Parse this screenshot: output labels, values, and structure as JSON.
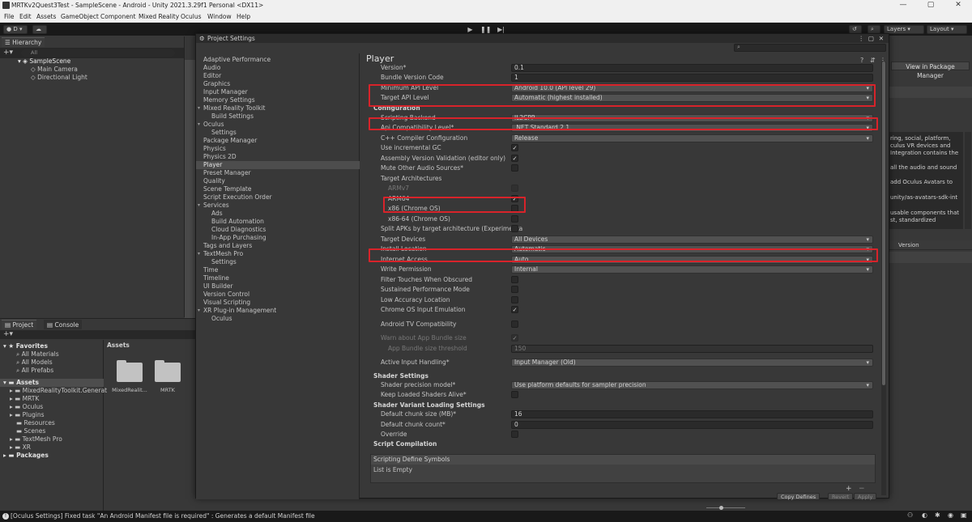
{
  "window": {
    "title": "MRTKv2Quest3Test - SampleScene - Android - Unity 2021.3.29f1 Personal <DX11>",
    "controls": [
      "—",
      "▢",
      "✕"
    ]
  },
  "menu": [
    "File",
    "Edit",
    "Assets",
    "GameObject",
    "Component",
    "Mixed Reality",
    "Oculus",
    "Window",
    "Help"
  ],
  "toolbar": {
    "account": "D",
    "layers": "Layers",
    "layout": "Layout"
  },
  "hierarchy": {
    "tab": "Hierarchy",
    "search_placeholder": "All",
    "scene": "SampleScene",
    "items": [
      "Main Camera",
      "Directional Light"
    ]
  },
  "project": {
    "tabs": [
      "Project",
      "Console"
    ],
    "favorites": {
      "label": "Favorites",
      "items": [
        "All Materials",
        "All Models",
        "All Prefabs"
      ]
    },
    "assets_root": "Assets",
    "asset_folders": [
      "MixedRealityToolkit.Generat",
      "MRTK",
      "Oculus",
      "Plugins",
      "Resources",
      "Scenes",
      "TextMesh Pro",
      "XR"
    ],
    "packages": "Packages",
    "breadcrumb": "Assets",
    "grid": [
      {
        "name": "MixedRealit..."
      },
      {
        "name": "MRTK"
      }
    ]
  },
  "settings": {
    "title": "Project Settings",
    "nav": [
      {
        "label": "Adaptive Performance",
        "level": 0
      },
      {
        "label": "Audio",
        "level": 0
      },
      {
        "label": "Editor",
        "level": 0
      },
      {
        "label": "Graphics",
        "level": 0
      },
      {
        "label": "Input Manager",
        "level": 0
      },
      {
        "label": "Memory Settings",
        "level": 0
      },
      {
        "label": "Mixed Reality Toolkit",
        "level": 0,
        "expanded": true
      },
      {
        "label": "Build Settings",
        "level": 1
      },
      {
        "label": "Oculus",
        "level": 0,
        "expanded": true
      },
      {
        "label": "Settings",
        "level": 1
      },
      {
        "label": "Package Manager",
        "level": 0
      },
      {
        "label": "Physics",
        "level": 0
      },
      {
        "label": "Physics 2D",
        "level": 0
      },
      {
        "label": "Player",
        "level": 0,
        "selected": true
      },
      {
        "label": "Preset Manager",
        "level": 0
      },
      {
        "label": "Quality",
        "level": 0
      },
      {
        "label": "Scene Template",
        "level": 0
      },
      {
        "label": "Script Execution Order",
        "level": 0
      },
      {
        "label": "Services",
        "level": 0,
        "expanded": true
      },
      {
        "label": "Ads",
        "level": 1
      },
      {
        "label": "Build Automation",
        "level": 1
      },
      {
        "label": "Cloud Diagnostics",
        "level": 1
      },
      {
        "label": "In-App Purchasing",
        "level": 1
      },
      {
        "label": "Tags and Layers",
        "level": 0
      },
      {
        "label": "TextMesh Pro",
        "level": 0,
        "expanded": true
      },
      {
        "label": "Settings",
        "level": 1
      },
      {
        "label": "Time",
        "level": 0
      },
      {
        "label": "Timeline",
        "level": 0
      },
      {
        "label": "UI Builder",
        "level": 0
      },
      {
        "label": "Version Control",
        "level": 0
      },
      {
        "label": "Visual Scripting",
        "level": 0
      },
      {
        "label": "XR Plug-in Management",
        "level": 0,
        "expanded": true
      },
      {
        "label": "Oculus",
        "level": 1
      }
    ],
    "header": "Player",
    "rows": [
      {
        "label": "Version*",
        "kind": "text",
        "value": "0.1"
      },
      {
        "label": "Bundle Version Code",
        "kind": "text",
        "value": "1"
      },
      {
        "label": "Minimum API Level",
        "kind": "dropdown",
        "value": "Android 10.0 (API level 29)"
      },
      {
        "label": "Target API Level",
        "kind": "dropdown",
        "value": "Automatic (highest installed)"
      },
      {
        "label": "Configuration",
        "kind": "section"
      },
      {
        "label": "Scripting Backend",
        "kind": "dropdown",
        "value": "IL2CPP"
      },
      {
        "label": "Api Compatibility Level*",
        "kind": "dropdown",
        "value": ".NET Standard 2.1"
      },
      {
        "label": "C++ Compiler Configuration",
        "kind": "dropdown",
        "value": "Release"
      },
      {
        "label": "Use incremental GC",
        "kind": "check",
        "value": "✓"
      },
      {
        "label": "Assembly Version Validation (editor only)",
        "kind": "check",
        "value": "✓"
      },
      {
        "label": "Mute Other Audio Sources*",
        "kind": "check",
        "value": ""
      },
      {
        "label": "Target Architectures",
        "kind": "label"
      },
      {
        "label": "ARMv7",
        "kind": "check",
        "value": "",
        "indent": true,
        "dim": true
      },
      {
        "label": "ARM64",
        "kind": "check",
        "value": "✓",
        "indent": true
      },
      {
        "label": "x86 (Chrome OS)",
        "kind": "check",
        "value": "",
        "indent": true
      },
      {
        "label": "x86-64 (Chrome OS)",
        "kind": "check",
        "value": "",
        "indent": true
      },
      {
        "label": "Split APKs by target architecture (Experimenta",
        "kind": "check",
        "value": ""
      },
      {
        "label": "Target Devices",
        "kind": "dropdown",
        "value": "All Devices"
      },
      {
        "label": "Install Location",
        "kind": "dropdown",
        "value": "Automatic"
      },
      {
        "label": "Internet Access",
        "kind": "dropdown",
        "value": "Auto"
      },
      {
        "label": "Write Permission",
        "kind": "dropdown",
        "value": "Internal"
      },
      {
        "label": "Filter Touches When Obscured",
        "kind": "check",
        "value": ""
      },
      {
        "label": "Sustained Performance Mode",
        "kind": "check",
        "value": ""
      },
      {
        "label": "Low Accuracy Location",
        "kind": "check",
        "value": ""
      },
      {
        "label": "Chrome OS Input Emulation",
        "kind": "check",
        "value": "✓"
      },
      {
        "label": "Android TV Compatibility",
        "kind": "check",
        "value": ""
      },
      {
        "label": "Warn about App Bundle size",
        "kind": "check",
        "value": "✓",
        "dim": true
      },
      {
        "label": "App Bundle size threshold",
        "kind": "text",
        "value": "150",
        "indent": true,
        "dim": true
      },
      {
        "label": "Active Input Handling*",
        "kind": "dropdown",
        "value": "Input Manager (Old)"
      },
      {
        "label": "Shader Settings",
        "kind": "section"
      },
      {
        "label": "Shader precision model*",
        "kind": "dropdown",
        "value": "Use platform defaults for sampler precision"
      },
      {
        "label": "Keep Loaded Shaders Alive*",
        "kind": "check",
        "value": ""
      },
      {
        "label": "Shader Variant Loading Settings",
        "kind": "section"
      },
      {
        "label": "Default chunk size (MB)*",
        "kind": "text",
        "value": "16"
      },
      {
        "label": "Default chunk count*",
        "kind": "text",
        "value": "0"
      },
      {
        "label": "Override",
        "kind": "check",
        "value": ""
      },
      {
        "label": "Script Compilation",
        "kind": "section"
      }
    ],
    "define_symbols": {
      "header": "Scripting Define Symbols",
      "empty": "List is Empty",
      "add": "+",
      "remove": "−"
    },
    "bottom_buttons": [
      "Copy Defines",
      "Revert",
      "Apply"
    ]
  },
  "right_panel": {
    "view_in_pm": "View in Package Manager",
    "desc_lines": [
      "ring, social, platform,",
      "culus VR devices and",
      "Integration contains the",
      "",
      "all the audio and sound",
      "",
      "add Oculus Avatars to",
      "",
      "unity/as-avatars-sdk-int",
      "",
      "usable components that",
      "st, standardized"
    ],
    "version_col": "Version"
  },
  "status": {
    "message": "[Oculus Settings] Fixed task \"An Android Manifest file is required\" : Generates a default Manifest file"
  },
  "highlight_color": "#d8232a"
}
